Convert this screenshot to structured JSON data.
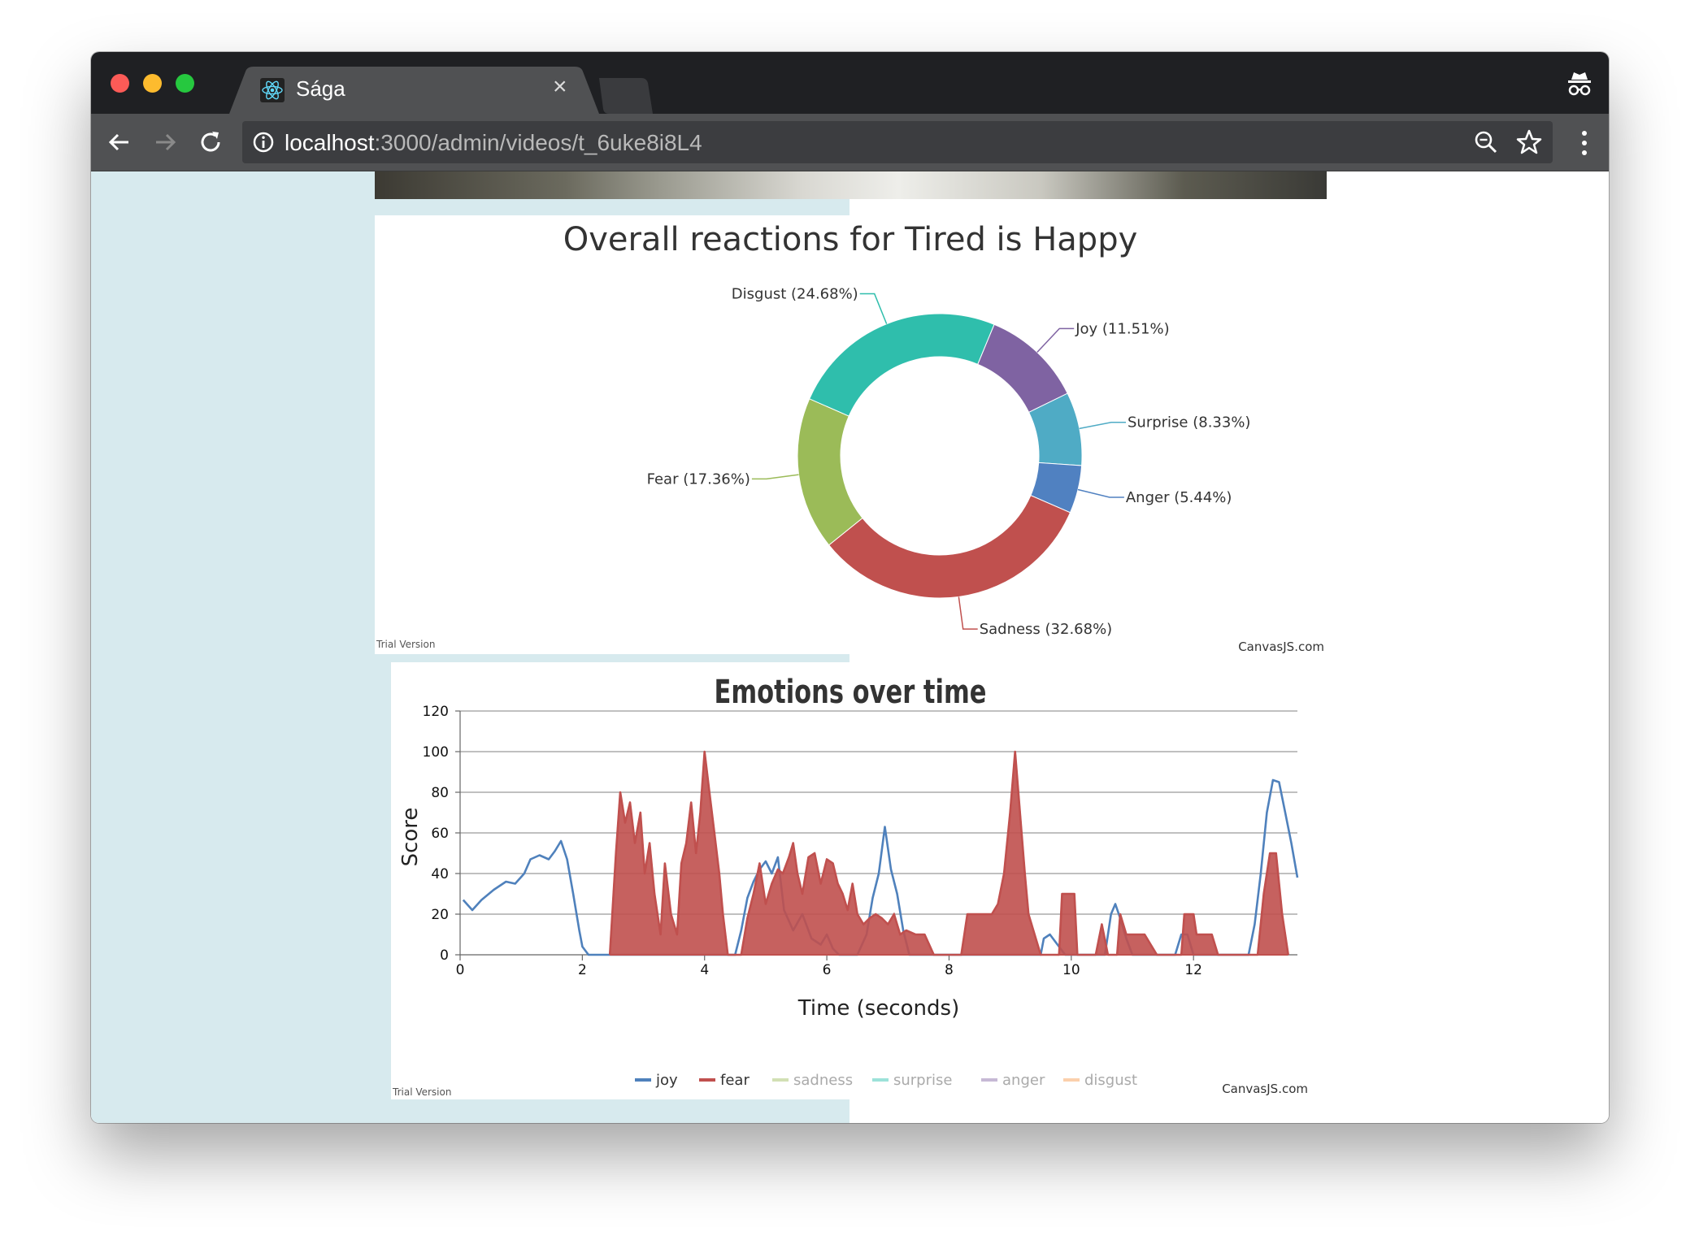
{
  "browser": {
    "tab_title": "Sága",
    "tab_close": "×",
    "url_host": "localhost",
    "url_rest": ":3000/admin/videos/t_6uke8i8L4",
    "icons": [
      "react-logo-icon",
      "close-icon",
      "incognito-icon",
      "back-icon",
      "forward-icon",
      "reload-icon",
      "info-icon",
      "zoom-icon",
      "star-icon",
      "menu-icon"
    ]
  },
  "watermarks": {
    "trial": "Trial Version",
    "brand": "CanvasJS.com"
  },
  "chart_data": [
    {
      "type": "pie",
      "style": "doughnut",
      "title": "Overall reactions for Tired is Happy",
      "slices": [
        {
          "label": "Joy (11.51%)",
          "name": "Joy",
          "value": 11.51,
          "color": "#7f63a2"
        },
        {
          "label": "Surprise (8.33%)",
          "name": "Surprise",
          "value": 8.33,
          "color": "#4fabc5"
        },
        {
          "label": "Anger (5.44%)",
          "name": "Anger",
          "value": 5.44,
          "color": "#5081c1"
        },
        {
          "label": "Sadness (32.68%)",
          "name": "Sadness",
          "value": 32.68,
          "color": "#c0504e"
        },
        {
          "label": "Fear (17.36%)",
          "name": "Fear",
          "value": 17.36,
          "color": "#9bbb58"
        },
        {
          "label": "Disgust (24.68%)",
          "name": "Disgust",
          "value": 24.68,
          "color": "#2fbeac"
        }
      ]
    },
    {
      "type": "line",
      "title": "Emotions over time",
      "xlabel": "Time (seconds)",
      "ylabel": "Score",
      "xlim": [
        0,
        13.7
      ],
      "ylim": [
        0,
        120
      ],
      "xticks": [
        0,
        2,
        4,
        6,
        8,
        10,
        12
      ],
      "yticks": [
        0,
        20,
        40,
        60,
        80,
        100,
        120
      ],
      "grid": true,
      "legend_position": "bottom",
      "series": [
        {
          "name": "joy",
          "color": "#4f81bc",
          "visible": true,
          "points": [
            [
              0.05,
              27
            ],
            [
              0.2,
              22
            ],
            [
              0.35,
              27
            ],
            [
              0.55,
              32
            ],
            [
              0.75,
              36
            ],
            [
              0.9,
              35
            ],
            [
              1.05,
              40
            ],
            [
              1.15,
              47
            ],
            [
              1.3,
              49
            ],
            [
              1.45,
              47
            ],
            [
              1.55,
              51
            ],
            [
              1.65,
              56
            ],
            [
              1.75,
              47
            ],
            [
              1.85,
              30
            ],
            [
              1.95,
              12
            ],
            [
              2.0,
              4
            ],
            [
              2.1,
              0
            ],
            [
              4.5,
              0
            ],
            [
              4.6,
              12
            ],
            [
              4.7,
              28
            ],
            [
              4.8,
              36
            ],
            [
              4.9,
              42
            ],
            [
              5.0,
              46
            ],
            [
              5.1,
              40
            ],
            [
              5.2,
              48
            ],
            [
              5.3,
              22
            ],
            [
              5.45,
              12
            ],
            [
              5.6,
              20
            ],
            [
              5.75,
              8
            ],
            [
              5.9,
              5
            ],
            [
              6.0,
              10
            ],
            [
              6.1,
              3
            ],
            [
              6.2,
              0
            ],
            [
              6.5,
              0
            ],
            [
              6.65,
              10
            ],
            [
              6.75,
              28
            ],
            [
              6.85,
              40
            ],
            [
              6.95,
              63
            ],
            [
              7.05,
              42
            ],
            [
              7.15,
              30
            ],
            [
              7.25,
              12
            ],
            [
              7.35,
              0
            ],
            [
              9.5,
              0
            ],
            [
              9.55,
              8
            ],
            [
              9.65,
              10
            ],
            [
              9.75,
              6
            ],
            [
              9.9,
              0
            ],
            [
              10.55,
              0
            ],
            [
              10.65,
              20
            ],
            [
              10.72,
              25
            ],
            [
              10.8,
              18
            ],
            [
              10.9,
              8
            ],
            [
              11.0,
              0
            ],
            [
              11.7,
              0
            ],
            [
              11.8,
              10
            ],
            [
              11.9,
              10
            ],
            [
              12.0,
              0
            ],
            [
              12.9,
              0
            ],
            [
              13.0,
              15
            ],
            [
              13.1,
              40
            ],
            [
              13.2,
              70
            ],
            [
              13.3,
              86
            ],
            [
              13.4,
              85
            ],
            [
              13.5,
              70
            ],
            [
              13.6,
              55
            ],
            [
              13.7,
              38
            ]
          ]
        },
        {
          "name": "fear",
          "color": "#c0504e",
          "visible": true,
          "points": [
            [
              2.45,
              0
            ],
            [
              2.55,
              50
            ],
            [
              2.62,
              80
            ],
            [
              2.7,
              65
            ],
            [
              2.78,
              75
            ],
            [
              2.86,
              55
            ],
            [
              2.95,
              70
            ],
            [
              3.02,
              40
            ],
            [
              3.1,
              55
            ],
            [
              3.18,
              30
            ],
            [
              3.28,
              10
            ],
            [
              3.35,
              45
            ],
            [
              3.45,
              20
            ],
            [
              3.55,
              10
            ],
            [
              3.62,
              45
            ],
            [
              3.7,
              55
            ],
            [
              3.78,
              75
            ],
            [
              3.86,
              50
            ],
            [
              3.93,
              70
            ],
            [
              4.0,
              100
            ],
            [
              4.08,
              80
            ],
            [
              4.16,
              60
            ],
            [
              4.24,
              40
            ],
            [
              4.3,
              20
            ],
            [
              4.38,
              0
            ],
            [
              4.6,
              0
            ],
            [
              4.7,
              18
            ],
            [
              4.8,
              30
            ],
            [
              4.9,
              45
            ],
            [
              5.0,
              25
            ],
            [
              5.1,
              35
            ],
            [
              5.2,
              42
            ],
            [
              5.28,
              40
            ],
            [
              5.38,
              48
            ],
            [
              5.45,
              55
            ],
            [
              5.52,
              40
            ],
            [
              5.6,
              30
            ],
            [
              5.7,
              48
            ],
            [
              5.8,
              50
            ],
            [
              5.9,
              35
            ],
            [
              6.0,
              47
            ],
            [
              6.1,
              45
            ],
            [
              6.18,
              35
            ],
            [
              6.26,
              30
            ],
            [
              6.34,
              22
            ],
            [
              6.42,
              35
            ],
            [
              6.5,
              20
            ],
            [
              6.6,
              15
            ],
            [
              6.7,
              18
            ],
            [
              6.8,
              20
            ],
            [
              6.9,
              18
            ],
            [
              7.0,
              15
            ],
            [
              7.1,
              20
            ],
            [
              7.2,
              10
            ],
            [
              7.3,
              12
            ],
            [
              7.45,
              10
            ],
            [
              7.6,
              10
            ],
            [
              7.75,
              0
            ],
            [
              8.2,
              0
            ],
            [
              8.3,
              20
            ],
            [
              8.5,
              20
            ],
            [
              8.7,
              20
            ],
            [
              8.8,
              25
            ],
            [
              8.9,
              40
            ],
            [
              9.0,
              70
            ],
            [
              9.08,
              100
            ],
            [
              9.16,
              70
            ],
            [
              9.24,
              40
            ],
            [
              9.3,
              20
            ],
            [
              9.4,
              10
            ],
            [
              9.5,
              0
            ],
            [
              9.8,
              0
            ],
            [
              9.85,
              30
            ],
            [
              10.05,
              30
            ],
            [
              10.1,
              0
            ],
            [
              10.4,
              0
            ],
            [
              10.5,
              15
            ],
            [
              10.6,
              0
            ],
            [
              10.75,
              0
            ],
            [
              10.8,
              20
            ],
            [
              10.9,
              10
            ],
            [
              11.2,
              10
            ],
            [
              11.4,
              0
            ],
            [
              11.8,
              0
            ],
            [
              11.85,
              20
            ],
            [
              12.0,
              20
            ],
            [
              12.05,
              10
            ],
            [
              12.3,
              10
            ],
            [
              12.4,
              0
            ],
            [
              13.05,
              0
            ],
            [
              13.15,
              30
            ],
            [
              13.25,
              50
            ],
            [
              13.35,
              50
            ],
            [
              13.45,
              20
            ],
            [
              13.55,
              0
            ]
          ]
        },
        {
          "name": "sadness",
          "color": "#9bbb58",
          "visible": false,
          "points": []
        },
        {
          "name": "surprise",
          "color": "#23bfaa",
          "visible": false,
          "points": []
        },
        {
          "name": "anger",
          "color": "#8064a1",
          "visible": false,
          "points": []
        },
        {
          "name": "disgust",
          "color": "#f79647",
          "visible": false,
          "points": []
        }
      ]
    }
  ]
}
